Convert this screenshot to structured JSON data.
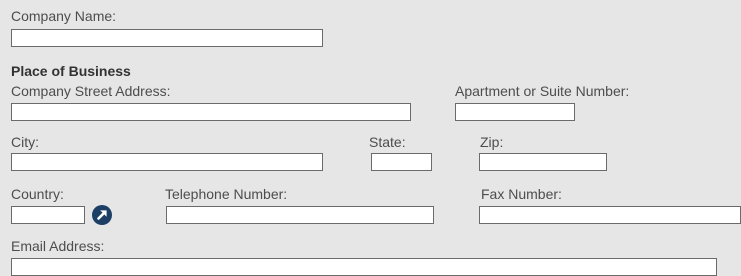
{
  "company": {
    "name_label": "Company Name:",
    "name_value": ""
  },
  "place_of_business": {
    "heading": "Place of Business",
    "street_label": "Company Street Address:",
    "street_value": "",
    "suite_label": "Apartment or Suite Number:",
    "suite_value": "",
    "city_label": "City:",
    "city_value": "",
    "state_label": "State:",
    "state_value": "",
    "zip_label": "Zip:",
    "zip_value": "",
    "country_label": "Country:",
    "country_value": "",
    "country_lookup_icon": "arrow-up-right-circle-icon",
    "phone_label": "Telephone Number:",
    "phone_value": "",
    "fax_label": "Fax Number:",
    "fax_value": "",
    "email_label": "Email Address:",
    "email_value": ""
  },
  "colors": {
    "background": "#e6e6e6",
    "lookup_icon": "#1c3f66"
  }
}
